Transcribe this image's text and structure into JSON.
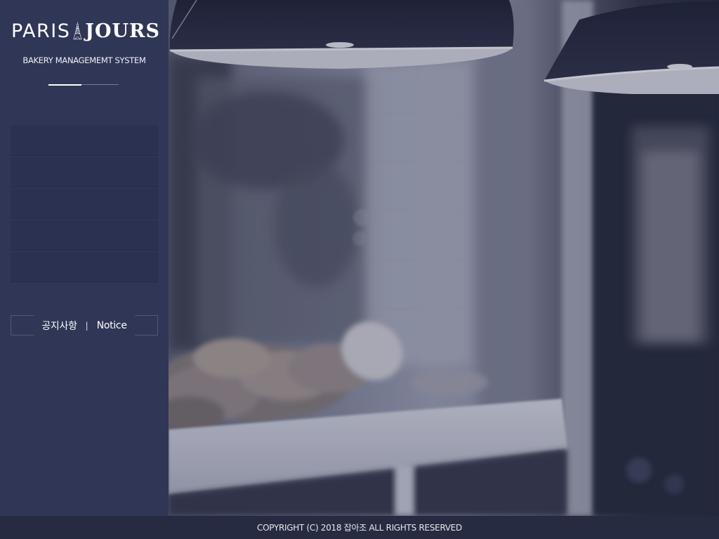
{
  "brand": {
    "name_left": "PARIS",
    "name_right": "JOURS",
    "subtitle": "BAKERY MANAGEMEMT SYSTEM"
  },
  "sidebar": {
    "menu_items": [
      "",
      "",
      "",
      "",
      ""
    ],
    "notice": {
      "korean": "공지사항",
      "separator": "|",
      "english": "Notice"
    }
  },
  "hero": {
    "icon": "bakery-photo"
  },
  "footer": {
    "copyright": "COPYRIGHT (C) 2018 잡아조 ALL RIGHTS RESERVED"
  },
  "colors": {
    "sidebar_bg": "#2f3656",
    "menu_item_bg": "#2b3151",
    "footer_bg": "#262b41",
    "text": "#ffffff"
  }
}
